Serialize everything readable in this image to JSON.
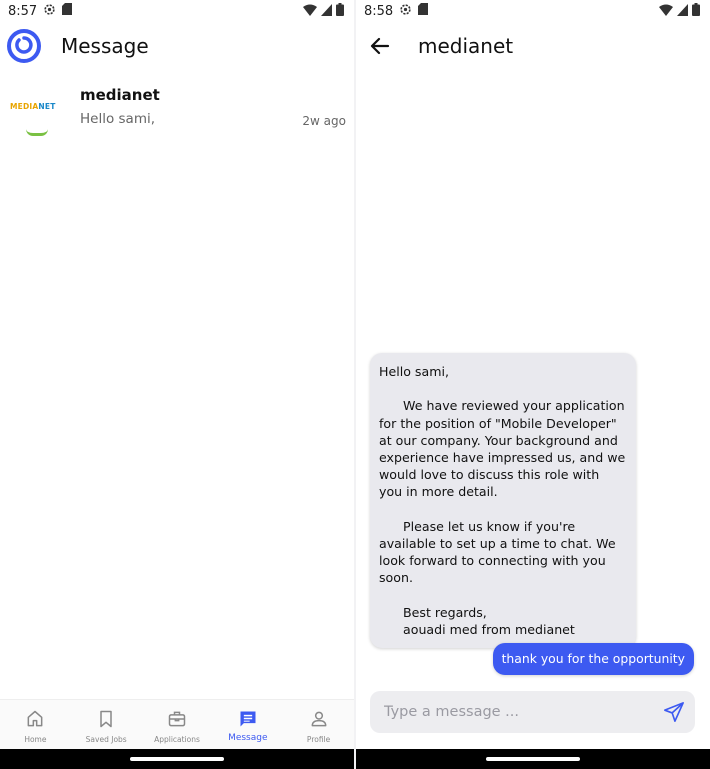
{
  "left_screen": {
    "status_time": "8:57",
    "header": {
      "title": "Message"
    },
    "conversations": [
      {
        "name": "medianet",
        "preview": "Hello sami,",
        "time": "2w ago",
        "logo_text_part1": "MEDIA",
        "logo_text_part2": "NET"
      }
    ],
    "bottom_nav": [
      {
        "label": "Home",
        "icon": "home-icon"
      },
      {
        "label": "Saved Jobs",
        "icon": "bookmark-icon"
      },
      {
        "label": "Applications",
        "icon": "briefcase-icon"
      },
      {
        "label": "Message",
        "icon": "message-icon",
        "active": true
      },
      {
        "label": "Profile",
        "icon": "person-icon"
      }
    ]
  },
  "right_screen": {
    "status_time": "8:58",
    "header": {
      "title": "medianet"
    },
    "messages": [
      {
        "direction": "incoming",
        "text": "Hello sami,\n\n      We have reviewed your application for the position of \"Mobile Developer\" at our company. Your background and experience have impressed us, and we would love to discuss this role with you in more detail.\n\n      Please let us know if you're available to set up a time to chat. We look forward to connecting with you soon.\n\n      Best regards,\n      aouadi med from medianet"
      },
      {
        "direction": "outgoing",
        "text": "thank you for the opportunity"
      }
    ],
    "composer": {
      "placeholder": "Type a message ...",
      "value": ""
    }
  },
  "colors": {
    "accent": "#3d5af1",
    "bubble_incoming": "#e9e9ee",
    "inactive_nav": "#888888"
  }
}
